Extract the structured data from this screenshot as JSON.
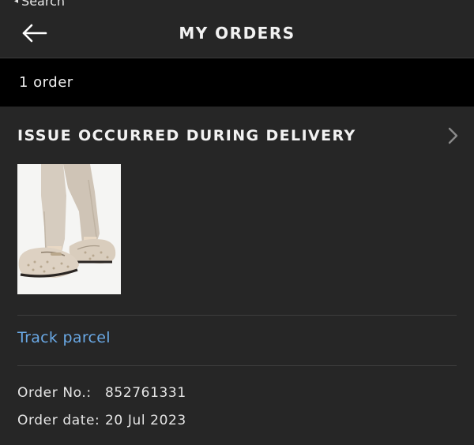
{
  "status_bar": {
    "back_label": "Search",
    "back_glyph": "◂"
  },
  "header": {
    "title": "MY ORDERS",
    "back_icon": "arrow-left-icon"
  },
  "summary": {
    "count_text": "1 order"
  },
  "order": {
    "status_title": "ISSUE OCCURRED DURING DELIVERY",
    "status_icon": "chevron-right-icon",
    "product_image": "beige-jacquard-loafers-product-photo",
    "track_label": "Track parcel",
    "order_no_label": "Order No.:",
    "order_no_value": "852761331",
    "order_date_label": "Order date:",
    "order_date_value": "20 Jul 2023"
  },
  "colors": {
    "background": "#262626",
    "count_bar": "#000000",
    "link": "#6aa9e6",
    "divider": "#3e3e3e"
  }
}
